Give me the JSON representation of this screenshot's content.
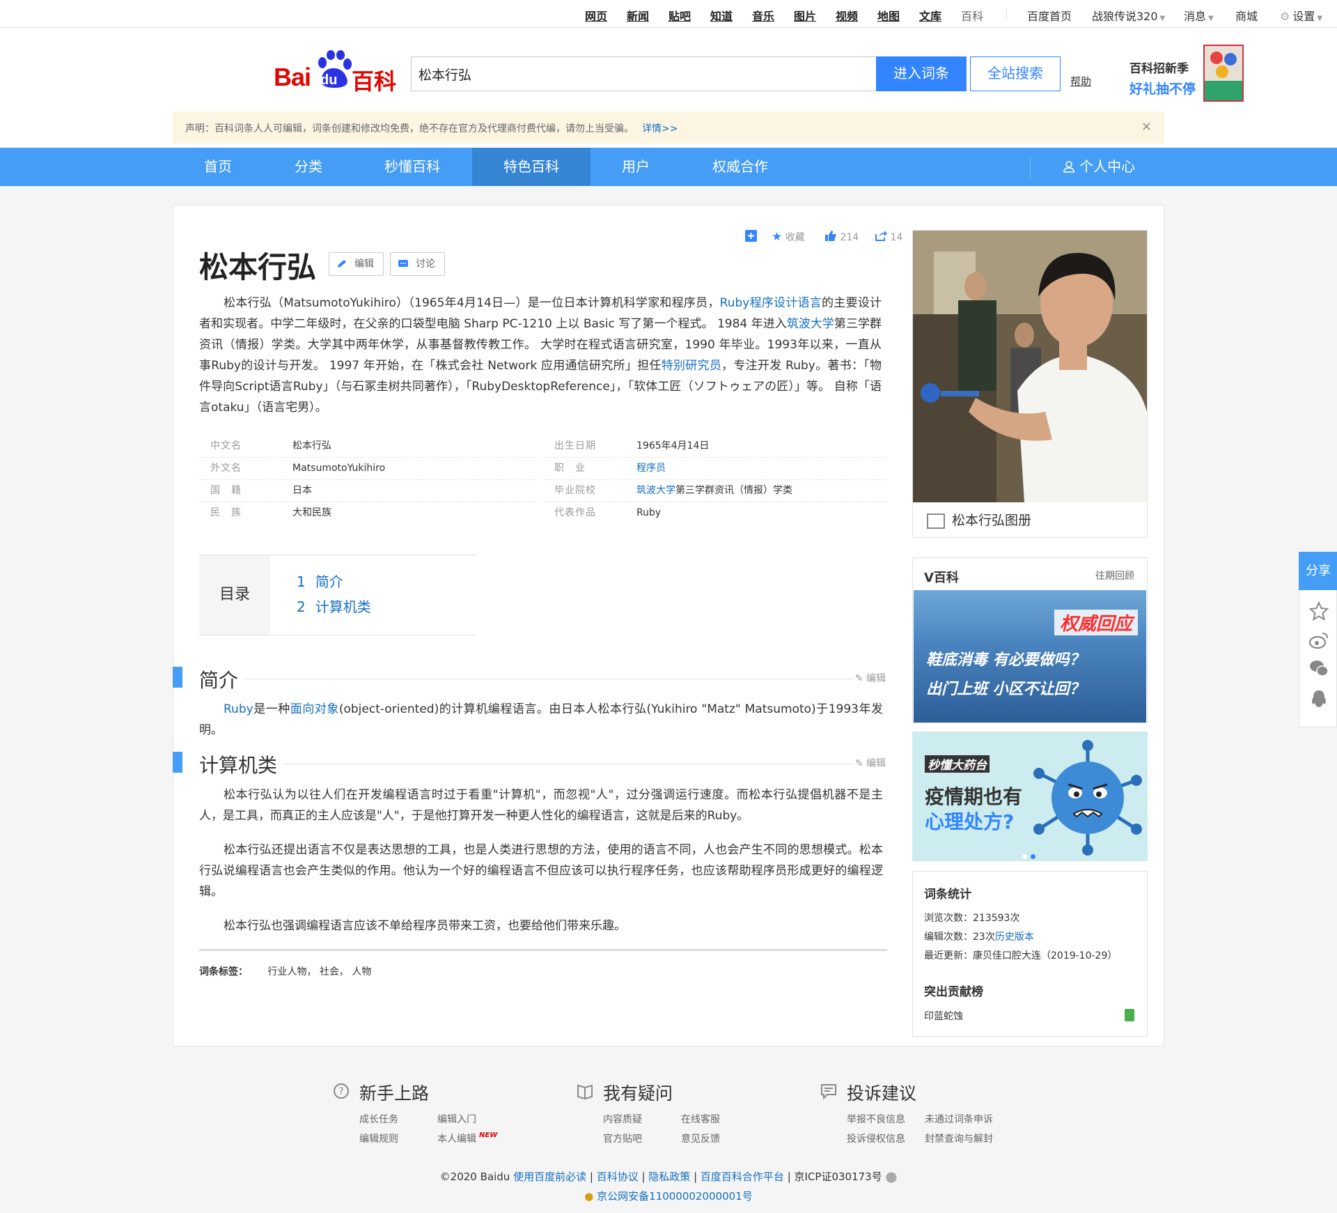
{
  "topbar": {
    "items": [
      "网页",
      "新闻",
      "贴吧",
      "知道",
      "音乐",
      "图片",
      "视频",
      "地图",
      "文库",
      "百科"
    ],
    "home": "百度首页",
    "user": "战狼传说320",
    "messages": "消息",
    "mall": "商城",
    "settings": "设置"
  },
  "header": {
    "logo_bai": "Bai",
    "logo_du": "du",
    "logo_baike": "百科",
    "search_value": "松本行弘",
    "enter_button": "进入词条",
    "site_search_button": "全站搜索",
    "help": "帮助",
    "promo_line1": "百科招新季",
    "promo_line2": "好礼抽不停"
  },
  "notice": {
    "text": "声明：百科词条人人可编辑，词条创建和修改均免费，绝不存在官方及代理商付费代编，请勿上当受骗。",
    "link": "详情>>",
    "close": "×"
  },
  "nav": {
    "items": [
      "首页",
      "分类",
      "秒懂百科",
      "特色百科",
      "用户",
      "权威合作"
    ],
    "active": "特色百科",
    "personal": "个人中心"
  },
  "article": {
    "title": "松本行弘",
    "edit_button": "编辑",
    "discuss_button": "讨论",
    "collect": "收藏",
    "likes": "214",
    "shares": "14",
    "summary": {
      "p1": "松本行弘（MatsumotoYukihiro）（1965年4月14日—）是一位日本计算机科学家和程序员，",
      "l1": "Ruby程序设计语言",
      "p2": "的主要设计者和实现者。中学二年级时，在父亲的口袋型电脑 Sharp PC-1210 上以 Basic 写了第一个程式。 1984 年进入",
      "l2": "筑波大学",
      "p3": "第三学群资讯（情报）学类。大学其中两年休学，从事基督教传教工作。 大学时在程式语言研究室，1990 年毕业。1993年以来，一直从事Ruby的设计与开发。 1997 年开始，在「株式会社 Network 应用通信研究所」担任",
      "l3": "特别研究员",
      "p4": "，专注开发 Ruby。著书：「物件导向Script语言Ruby」（与石冢圭树共同著作），「RubyDesktopReference」，「软体工匠（ソフトゥェアの匠）」等。 自称「语言otaku」（语言宅男）。"
    },
    "infobox": {
      "left": [
        {
          "k": "中文名",
          "v": "松本行弘"
        },
        {
          "k": "外文名",
          "v": "MatsumotoYukihiro"
        },
        {
          "k": "国　籍",
          "v": "日本"
        },
        {
          "k": "民　族",
          "v": "大和民族"
        }
      ],
      "right": [
        {
          "k": "出生日期",
          "v": "1965年4月14日"
        },
        {
          "k": "职　业",
          "v_link": "程序员"
        },
        {
          "k": "毕业院校",
          "v_link": "筑波大学",
          "v": "第三学群资讯（情报）学类"
        },
        {
          "k": "代表作品",
          "v": "Ruby"
        }
      ]
    },
    "toc": {
      "label": "目录",
      "items": [
        {
          "n": "1",
          "label": "简介"
        },
        {
          "n": "2",
          "label": "计算机类"
        }
      ]
    },
    "section1": {
      "title": "简介",
      "edit": "编辑",
      "l1": "Ruby",
      "t1": "是一种",
      "l2": "面向对象",
      "t2": "(object-oriented)的计算机编程语言。由日本人松本行弘(Yukihiro \"Matz\" Matsumoto)于1993年发明。"
    },
    "section2": {
      "title": "计算机类",
      "edit": "编辑",
      "p1": "松本行弘认为以往人们在开发编程语言时过于看重\"计算机\"，而忽视\"人\"，过分强调运行速度。而松本行弘提倡机器不是主人，是工具，而真正的主人应该是\"人\"，于是他打算开发一种更人性化的编程语言，这就是后来的Ruby。",
      "p2": "松本行弘还提出语言不仅是表达思想的工具，也是人类进行思想的方法，使用的语言不同，人也会产生不同的思想模式。松本行弘说编程语言也会产生类似的作用。他认为一个好的编程语言不但应该可以执行程序任务，也应该帮助程序员形成更好的编程逻辑。",
      "p3": "松本行弘也强调编程语言应该不单给程序员带来工资，也要给他们带来乐趣。"
    },
    "tags": {
      "label": "词条标签：",
      "items": [
        "行业人物",
        "社会",
        "人物"
      ]
    }
  },
  "sidebar": {
    "album_caption": "松本行弘图册",
    "vbaike_title": "V百科",
    "vbaike_more": "往期回顾",
    "vbaike_img_text1": "权威回应",
    "vbaike_img_text2": "鞋底消毒 有必要做吗？",
    "vbaike_img_text3": "出门上班 小区不让回？",
    "ad_logo": "秒懂大药台",
    "ad_line1": "疫情期也有",
    "ad_line2": "心理处方?",
    "stats_title": "词条统计",
    "views": "浏览次数：213593次",
    "edits_prefix": "编辑次数：23次",
    "edits_link": "历史版本",
    "last_update": "最近更新：康贝佳口腔大连（2019-10-29）",
    "contrib_title": "突出贡献榜",
    "contributor": "印蓝蛇蚀"
  },
  "share": {
    "label": "分享"
  },
  "footer": {
    "col1": {
      "title": "新手上路",
      "links": [
        "成长任务",
        "编辑入门",
        "编辑规则",
        "本人编辑"
      ],
      "new_badge": "NEW"
    },
    "col2": {
      "title": "我有疑问",
      "links": [
        "内容质疑",
        "在线客服",
        "官方贴吧",
        "意见反馈"
      ]
    },
    "col3": {
      "title": "投诉建议",
      "links": [
        "举报不良信息",
        "未通过词条申诉",
        "投诉侵权信息",
        "封禁查询与解封"
      ]
    },
    "copyright": "©2020 Baidu",
    "links": [
      "使用百度前必读",
      "百科协议",
      "隐私政策",
      "百度百科合作平台"
    ],
    "icp": "京ICP证030173号",
    "police": "京公网安备11000002000001号"
  },
  "colors": {
    "brand_red": "#e10601",
    "nav_blue": "#459df5",
    "link_blue": "#136ec2",
    "button_blue": "#3385ff"
  }
}
